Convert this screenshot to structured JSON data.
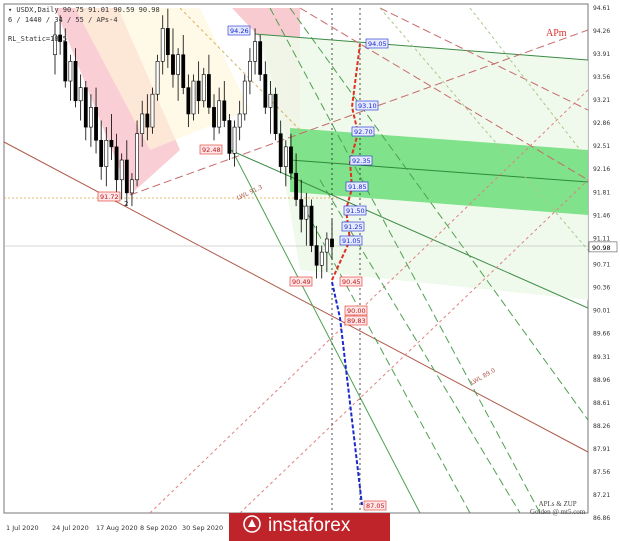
{
  "header": {
    "title": "▾ USDX,Daily  90.75 91.01 90.59 90.98",
    "subtitle": "6 / 1440 / 34 / 55 / APs-4",
    "indicator": "RL_Static=18.5",
    "badge": "APm"
  },
  "footer": {
    "apls_line1": "APLs & ZUP",
    "apls_line2": "Golden @ mt5.com",
    "brand_text": "instaforex"
  },
  "colors": {
    "up_target": "#e03020",
    "down_target": "#1a2ad0",
    "green_channel": "#5bd96b",
    "pink_fork": "#f08a96",
    "brown_line": "#b05a4a"
  },
  "chart_data": {
    "type": "candlestick",
    "symbol": "USDX",
    "timeframe": "Daily",
    "ylim": [
      86.86,
      94.61
    ],
    "y_ticks": [
      "94.61",
      "94.26",
      "93.91",
      "93.56",
      "93.21",
      "92.86",
      "92.51",
      "92.16",
      "91.81",
      "91.46",
      "91.11",
      "90.71",
      "90.36",
      "90.01",
      "89.66",
      "89.31",
      "88.96",
      "88.61",
      "88.26",
      "87.91",
      "87.56",
      "87.21",
      "86.86"
    ],
    "current_price_label": "90.98",
    "x_tick_labels": [
      "1 Jul 2020",
      "24 Jul 2020",
      "17 Aug 2020",
      "8 Sep 2020",
      "30 Sep 2020"
    ],
    "price_labels_red": [
      "91.72",
      "92.48",
      "90.49",
      "90.45",
      "90.00",
      "89.83",
      "87.05"
    ],
    "price_labels_blue": [
      "94.26",
      "94.05",
      "93.10",
      "92.70",
      "92.35",
      "91.85",
      "91.50",
      "91.25",
      "91.05"
    ],
    "trendline_labels": [
      "LWL 91.3",
      "LWL 89.0"
    ],
    "pivot_labels": [
      "2"
    ],
    "candles": [
      [
        93.9,
        94.4,
        93.6,
        94.2
      ],
      [
        94.2,
        94.5,
        93.9,
        94.1
      ],
      [
        94.1,
        94.3,
        93.4,
        93.5
      ],
      [
        93.5,
        93.9,
        93.2,
        93.8
      ],
      [
        93.8,
        94.0,
        93.1,
        93.2
      ],
      [
        93.2,
        93.6,
        92.9,
        93.4
      ],
      [
        93.4,
        93.5,
        92.6,
        92.8
      ],
      [
        92.8,
        93.3,
        92.5,
        93.1
      ],
      [
        93.1,
        93.4,
        92.4,
        92.6
      ],
      [
        92.6,
        92.9,
        92.0,
        92.2
      ],
      [
        92.2,
        92.8,
        91.9,
        92.6
      ],
      [
        92.6,
        93.0,
        92.3,
        92.5
      ],
      [
        92.5,
        92.7,
        91.8,
        92.0
      ],
      [
        92.0,
        92.4,
        91.7,
        92.3
      ],
      [
        92.3,
        92.6,
        91.6,
        91.8
      ],
      [
        91.8,
        92.1,
        91.6,
        92.0
      ],
      [
        92.0,
        92.9,
        91.9,
        92.7
      ],
      [
        92.7,
        93.2,
        92.5,
        93.0
      ],
      [
        93.0,
        93.3,
        92.6,
        92.8
      ],
      [
        92.8,
        93.4,
        92.7,
        93.3
      ],
      [
        93.3,
        93.9,
        93.2,
        93.8
      ],
      [
        93.8,
        94.5,
        93.6,
        94.3
      ],
      [
        94.3,
        94.6,
        93.7,
        93.9
      ],
      [
        93.9,
        94.3,
        93.4,
        93.6
      ],
      [
        93.6,
        94.0,
        93.2,
        93.9
      ],
      [
        93.9,
        94.2,
        93.3,
        93.4
      ],
      [
        93.4,
        93.6,
        92.8,
        93.0
      ],
      [
        93.0,
        93.6,
        92.9,
        93.5
      ],
      [
        93.5,
        93.8,
        93.0,
        93.2
      ],
      [
        93.2,
        93.7,
        93.1,
        93.6
      ],
      [
        93.6,
        93.9,
        93.0,
        93.1
      ],
      [
        93.1,
        93.3,
        92.6,
        92.8
      ],
      [
        92.8,
        93.4,
        92.7,
        93.2
      ],
      [
        93.2,
        93.5,
        92.8,
        92.9
      ],
      [
        92.9,
        93.0,
        92.3,
        92.4
      ],
      [
        92.4,
        92.9,
        92.2,
        92.8
      ],
      [
        92.8,
        93.2,
        92.6,
        93.0
      ],
      [
        93.0,
        93.6,
        92.9,
        93.5
      ],
      [
        93.5,
        94.0,
        93.3,
        93.8
      ],
      [
        93.8,
        94.3,
        93.6,
        94.1
      ],
      [
        94.1,
        94.2,
        93.5,
        93.6
      ],
      [
        93.6,
        93.8,
        93.0,
        93.1
      ],
      [
        93.1,
        93.5,
        92.7,
        93.3
      ],
      [
        93.3,
        93.4,
        92.6,
        92.7
      ],
      [
        92.7,
        92.9,
        92.1,
        92.2
      ],
      [
        92.2,
        92.6,
        91.9,
        92.5
      ],
      [
        92.5,
        92.7,
        92.0,
        92.1
      ],
      [
        92.1,
        92.4,
        91.6,
        91.7
      ],
      [
        91.7,
        92.0,
        91.2,
        91.4
      ],
      [
        91.4,
        91.8,
        91.0,
        91.6
      ],
      [
        91.6,
        91.7,
        90.9,
        91.0
      ],
      [
        91.0,
        91.3,
        90.5,
        90.7
      ],
      [
        90.7,
        91.0,
        90.5,
        90.9
      ],
      [
        90.9,
        91.2,
        90.6,
        91.1
      ],
      [
        91.1,
        91.4,
        90.8,
        90.98
      ]
    ]
  }
}
